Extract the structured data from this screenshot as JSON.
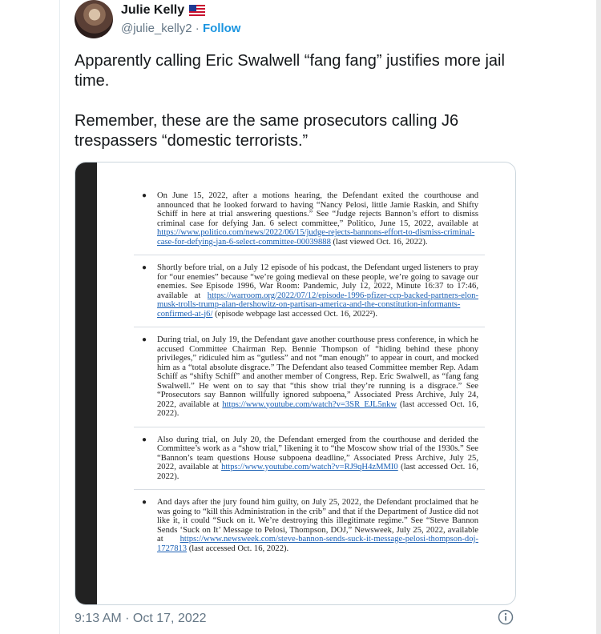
{
  "user": {
    "name": "Julie Kelly",
    "flag_icon": "us-flag-icon",
    "handle": "@julie_kelly2",
    "separator": " · ",
    "follow_label": "Follow"
  },
  "tweet": {
    "paragraph1": "Apparently calling Eric Swalwell “fang fang” justifies more jail time.",
    "paragraph2": "Remember, these are the same prosecutors calling J6 trespassers “domestic terrorists.”"
  },
  "document": {
    "items": [
      {
        "before": "On June 15, 2022, after a motions hearing, the Defendant exited the courthouse and announced that he looked forward to having “Nancy Pelosi, little Jamie Raskin, and Shifty Schiff in here at trial answering questions.” See “Judge rejects Bannon’s effort to dismiss criminal case for defying Jan. 6 select committee,” Politico, June 15, 2022, available at ",
        "link": "https://www.politico.com/news/2022/06/15/judge-rejects-bannons-effort-to-dismiss-criminal-case-for-defying-jan-6-select-committee-00039888",
        "after": " (last viewed Oct. 16, 2022)."
      },
      {
        "before": "Shortly before trial, on a July 12 episode of his podcast, the Defendant urged listeners to pray for “our enemies” because “we’re going medieval on these people, we’re going to savage our enemies. See Episode 1996, War Room: Pandemic, July 12, 2022, Minute 16:37 to 17:46, available at ",
        "link": "https://warroom.org/2022/07/12/episode-1996-pfizer-ccp-backed-partners-elon-musk-trolls-trump-alan-dershowitz-on-partisan-america-and-the-constitution-informants-confirmed-at-j6/",
        "after": " (episode webpage last accessed Oct. 16, 2022²)."
      },
      {
        "before": "During trial, on July 19, the Defendant gave another courthouse press conference, in which he accused Committee Chairman Rep. Bennie Thompson of “hiding behind these phony privileges,” ridiculed him as “gutless” and not “man enough” to appear in court, and mocked him as a “total absolute disgrace.” The Defendant also teased Committee member Rep. Adam Schiff as “shifty Schiff” and another member of Congress, Rep. Eric Swalwell, as “fang fang Swalwell.” He went on to say that “this show trial they’re running is a disgrace.” See “Prosecutors say Bannon willfully ignored subpoena,” Associated Press Archive, July 24, 2022, available at ",
        "link": "https://www.youtube.com/watch?v=3SR_EJL5nkw",
        "after": " (last accessed Oct. 16, 2022)."
      },
      {
        "before": "Also during trial, on July 20, the Defendant emerged from the courthouse and derided the Committee’s work as a “show trial,” likening it to “the Moscow show trial of the 1930s.” See “Bannon’s team questions House subpoena deadline,” Associated Press Archive, July 25, 2022, available at ",
        "link": "https://www.youtube.com/watch?v=RJ9qH4zMMI0",
        "after": " (last accessed Oct. 16, 2022)."
      },
      {
        "before": "And days after the jury found him guilty, on July 25, 2022, the Defendant proclaimed that he was going to “kill this Administration in the crib” and that if the Department of Justice did not like it, it could “Suck on it. We’re destroying this illegitimate regime.” See “Steve Bannon Sends ‘Suck on It’ Message to Pelosi, Thompson, DOJ,” Newsweek, July 25, 2022, available at ",
        "link": "https://www.newsweek.com/steve-bannon-sends-suck-it-message-pelosi-thompson-doj-1727813",
        "after": " (last accessed Oct. 16, 2022)."
      }
    ]
  },
  "footer": {
    "timestamp": "9:13 AM · Oct 17, 2022",
    "info_icon": "info-icon"
  }
}
